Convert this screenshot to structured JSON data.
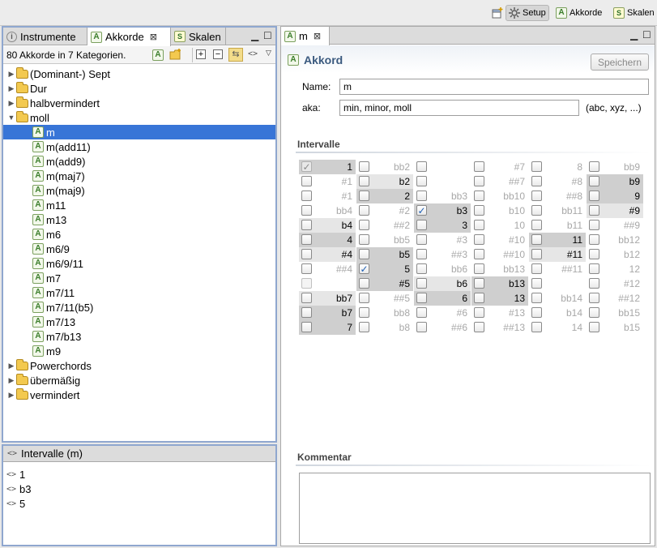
{
  "toolbar": {
    "items": [
      {
        "name": "open-perspective",
        "label": ""
      },
      {
        "name": "setup",
        "label": "Setup"
      },
      {
        "name": "akkorde",
        "label": "Akkorde"
      },
      {
        "name": "skalen",
        "label": "Skalen"
      }
    ]
  },
  "left_panel": {
    "tabs": [
      {
        "label": "Instrumente"
      },
      {
        "label": "Akkorde"
      },
      {
        "label": "Skalen"
      }
    ],
    "summary": "80 Akkorde in 7 Kategorien.",
    "tree": [
      {
        "label": "(Dominant-) Sept",
        "type": "folder",
        "expanded": false
      },
      {
        "label": "Dur",
        "type": "folder",
        "expanded": false
      },
      {
        "label": "halbvermindert",
        "type": "folder",
        "expanded": false
      },
      {
        "label": "moll",
        "type": "folder",
        "expanded": true
      },
      {
        "label": "m",
        "type": "chord",
        "selected": true
      },
      {
        "label": "m(add11)",
        "type": "chord"
      },
      {
        "label": "m(add9)",
        "type": "chord"
      },
      {
        "label": "m(maj7)",
        "type": "chord"
      },
      {
        "label": "m(maj9)",
        "type": "chord"
      },
      {
        "label": "m11",
        "type": "chord"
      },
      {
        "label": "m13",
        "type": "chord"
      },
      {
        "label": "m6",
        "type": "chord"
      },
      {
        "label": "m6/9",
        "type": "chord"
      },
      {
        "label": "m6/9/11",
        "type": "chord"
      },
      {
        "label": "m7",
        "type": "chord"
      },
      {
        "label": "m7/11",
        "type": "chord"
      },
      {
        "label": "m7/11(b5)",
        "type": "chord"
      },
      {
        "label": "m7/13",
        "type": "chord"
      },
      {
        "label": "m7/b13",
        "type": "chord"
      },
      {
        "label": "m9",
        "type": "chord"
      },
      {
        "label": "Powerchords",
        "type": "folder",
        "expanded": false
      },
      {
        "label": "übermäßig",
        "type": "folder",
        "expanded": false
      },
      {
        "label": "vermindert",
        "type": "folder",
        "expanded": false
      }
    ],
    "intervals_title": "Intervalle (m)",
    "intervals": [
      "1",
      "b3",
      "5"
    ]
  },
  "editor": {
    "tab": "m",
    "header": "Akkord",
    "save_label": "Speichern",
    "name_label": "Name:",
    "name_value": "m",
    "aka_label": "aka:",
    "aka_value": "min, minor, moll",
    "aka_hint": "(abc, xyz, ...)",
    "intervals_section": "Intervalle",
    "comment_section": "Kommentar",
    "comment_value": "",
    "grid": [
      [
        {
          "l": "1",
          "s": "sel",
          "c": "dimon",
          "d": false
        },
        {
          "l": "#1",
          "s": "",
          "c": "off",
          "d": true
        },
        {
          "l": "#1",
          "s": "",
          "c": "off",
          "d": true
        },
        {
          "l": "bb4",
          "s": "",
          "c": "off",
          "d": true
        },
        {
          "l": "b4",
          "s": "ghost",
          "c": "off",
          "d": false
        },
        {
          "l": "4",
          "s": "sel",
          "c": "off",
          "d": false
        },
        {
          "l": "#4",
          "s": "ghost",
          "c": "off",
          "d": false
        },
        {
          "l": "##4",
          "s": "",
          "c": "off",
          "d": true
        },
        {
          "l": "",
          "s": "",
          "c": "dim",
          "d": true
        },
        {
          "l": "bb7",
          "s": "ghost",
          "c": "off",
          "d": false
        },
        {
          "l": "b7",
          "s": "sel",
          "c": "off",
          "d": false
        },
        {
          "l": "7",
          "s": "sel",
          "c": "off",
          "d": false
        }
      ],
      [
        {
          "l": "bb2",
          "s": "",
          "c": "off",
          "d": true
        },
        {
          "l": "b2",
          "s": "ghost",
          "c": "off",
          "d": false
        },
        {
          "l": "2",
          "s": "sel",
          "c": "off",
          "d": false
        },
        {
          "l": "#2",
          "s": "",
          "c": "off",
          "d": true
        },
        {
          "l": "##2",
          "s": "",
          "c": "off",
          "d": true
        },
        {
          "l": "bb5",
          "s": "",
          "c": "off",
          "d": true
        },
        {
          "l": "b5",
          "s": "sel",
          "c": "off",
          "d": false
        },
        {
          "l": "5",
          "s": "sel",
          "c": "on",
          "d": false
        },
        {
          "l": "#5",
          "s": "sel",
          "c": "off",
          "d": false
        },
        {
          "l": "##5",
          "s": "",
          "c": "off",
          "d": true
        },
        {
          "l": "bb8",
          "s": "",
          "c": "off",
          "d": true
        },
        {
          "l": "b8",
          "s": "",
          "c": "off",
          "d": true
        }
      ],
      [
        {
          "l": "",
          "s": "",
          "c": "off",
          "d": true
        },
        {
          "l": "",
          "s": "",
          "c": "off",
          "d": true
        },
        {
          "l": "bb3",
          "s": "",
          "c": "off",
          "d": true
        },
        {
          "l": "b3",
          "s": "sel",
          "c": "on",
          "d": false
        },
        {
          "l": "3",
          "s": "sel",
          "c": "off",
          "d": false
        },
        {
          "l": "#3",
          "s": "",
          "c": "off",
          "d": true
        },
        {
          "l": "##3",
          "s": "",
          "c": "off",
          "d": true
        },
        {
          "l": "bb6",
          "s": "",
          "c": "off",
          "d": true
        },
        {
          "l": "b6",
          "s": "ghost",
          "c": "off",
          "d": false
        },
        {
          "l": "6",
          "s": "sel",
          "c": "off",
          "d": false
        },
        {
          "l": "#6",
          "s": "",
          "c": "off",
          "d": true
        },
        {
          "l": "##6",
          "s": "",
          "c": "off",
          "d": true
        }
      ],
      [
        {
          "l": "#7",
          "s": "",
          "c": "off",
          "d": true
        },
        {
          "l": "##7",
          "s": "",
          "c": "off",
          "d": true
        },
        {
          "l": "bb10",
          "s": "",
          "c": "off",
          "d": true
        },
        {
          "l": "b10",
          "s": "",
          "c": "off",
          "d": true
        },
        {
          "l": "10",
          "s": "",
          "c": "off",
          "d": true
        },
        {
          "l": "#10",
          "s": "",
          "c": "off",
          "d": true
        },
        {
          "l": "##10",
          "s": "",
          "c": "off",
          "d": true
        },
        {
          "l": "bb13",
          "s": "",
          "c": "off",
          "d": true
        },
        {
          "l": "b13",
          "s": "sel",
          "c": "off",
          "d": false
        },
        {
          "l": "13",
          "s": "sel",
          "c": "off",
          "d": false
        },
        {
          "l": "#13",
          "s": "",
          "c": "off",
          "d": true
        },
        {
          "l": "##13",
          "s": "",
          "c": "off",
          "d": true
        }
      ],
      [
        {
          "l": "8",
          "s": "",
          "c": "off",
          "d": true
        },
        {
          "l": "#8",
          "s": "",
          "c": "off",
          "d": true
        },
        {
          "l": "##8",
          "s": "",
          "c": "off",
          "d": true
        },
        {
          "l": "bb11",
          "s": "",
          "c": "off",
          "d": true
        },
        {
          "l": "b11",
          "s": "",
          "c": "off",
          "d": true
        },
        {
          "l": "11",
          "s": "sel",
          "c": "off",
          "d": false
        },
        {
          "l": "#11",
          "s": "ghost",
          "c": "off",
          "d": false
        },
        {
          "l": "##11",
          "s": "",
          "c": "off",
          "d": true
        },
        {
          "l": "",
          "s": "",
          "c": "off",
          "d": true
        },
        {
          "l": "bb14",
          "s": "",
          "c": "off",
          "d": true
        },
        {
          "l": "b14",
          "s": "",
          "c": "off",
          "d": true
        },
        {
          "l": "14",
          "s": "",
          "c": "off",
          "d": true
        }
      ],
      [
        {
          "l": "bb9",
          "s": "",
          "c": "off",
          "d": true
        },
        {
          "l": "b9",
          "s": "sel",
          "c": "off",
          "d": false
        },
        {
          "l": "9",
          "s": "sel",
          "c": "off",
          "d": false
        },
        {
          "l": "#9",
          "s": "ghost",
          "c": "off",
          "d": false
        },
        {
          "l": "##9",
          "s": "",
          "c": "off",
          "d": true
        },
        {
          "l": "bb12",
          "s": "",
          "c": "off",
          "d": true
        },
        {
          "l": "b12",
          "s": "",
          "c": "off",
          "d": true
        },
        {
          "l": "12",
          "s": "",
          "c": "off",
          "d": true
        },
        {
          "l": "#12",
          "s": "",
          "c": "off",
          "d": true
        },
        {
          "l": "##12",
          "s": "",
          "c": "off",
          "d": true
        },
        {
          "l": "bb15",
          "s": "",
          "c": "off",
          "d": true
        },
        {
          "l": "b15",
          "s": "",
          "c": "off",
          "d": true
        }
      ]
    ]
  },
  "colors": {
    "selection": "#3875d7",
    "panel_border": "#8fa7cf",
    "header_text": "#3b5a7f"
  }
}
